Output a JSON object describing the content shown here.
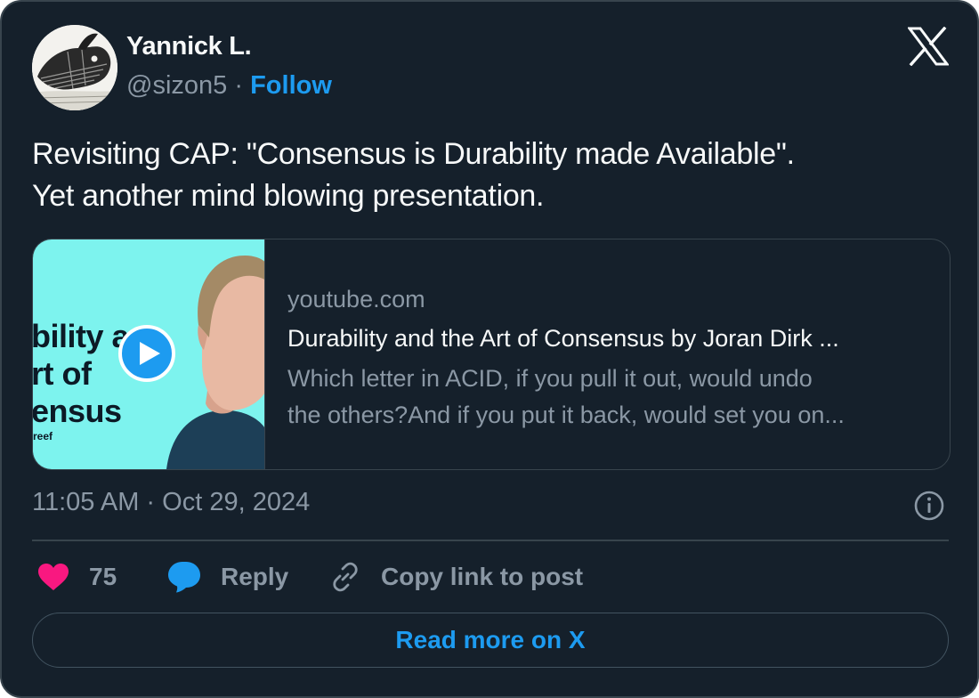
{
  "author": {
    "name": "Yannick L.",
    "handle": "@sizon5",
    "separator": "·",
    "follow_label": "Follow"
  },
  "brand": {
    "logo_icon": "x-logo-icon"
  },
  "tweet": {
    "lines": [
      "Revisiting CAP: \"Consensus is Durability made Available\".",
      "Yet another mind blowing presentation."
    ]
  },
  "link_card": {
    "thumbnail_text": [
      "bility a",
      "rt of",
      "ensus"
    ],
    "thumbnail_small": "reef",
    "play_icon": "play-icon",
    "domain": "youtube.com",
    "title": "Durability and the Art of Consensus by Joran Dirk ...",
    "description_lines": [
      "Which letter in ACID, if you pull it out, would undo",
      "the others?And if you put it back, would set you on..."
    ]
  },
  "timestamp": "11:05 AM · Oct 29, 2024",
  "actions": {
    "like_count": "75",
    "reply_label": "Reply",
    "copy_label": "Copy link to post"
  },
  "read_more_label": "Read more on X",
  "colors": {
    "background": "#15202b",
    "border": "#38444d",
    "accent": "#1d9bf0",
    "muted_text": "#8b98a5",
    "like": "#f91880",
    "thumbnail_bg": "#7df3ee"
  }
}
